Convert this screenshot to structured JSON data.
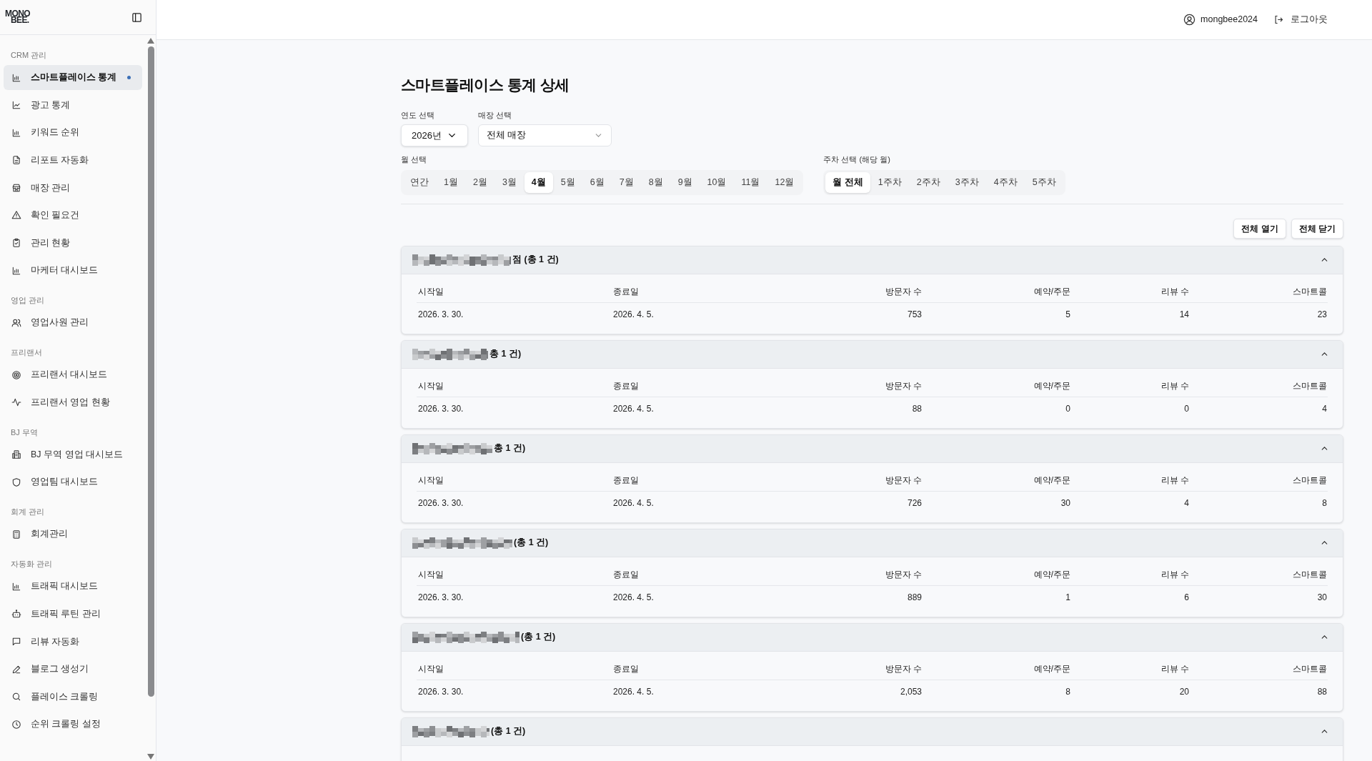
{
  "sidebar": {
    "logo": [
      "MONO",
      "BEE."
    ],
    "groups": [
      {
        "label": "CRM 관리",
        "items": [
          {
            "label": "스마트플레이스 통계",
            "selected": true
          },
          {
            "label": "광고 통계",
            "selected": false
          },
          {
            "label": "키워드 순위",
            "selected": false
          },
          {
            "label": "리포트 자동화",
            "selected": false
          },
          {
            "label": "매장 관리",
            "selected": false
          },
          {
            "label": "확인 필요건",
            "selected": false
          },
          {
            "label": "관리 현황",
            "selected": false
          },
          {
            "label": "마케터 대시보드",
            "selected": false
          }
        ]
      },
      {
        "label": "영업 관리",
        "items": [
          {
            "label": "영업사원 관리",
            "selected": false
          }
        ]
      },
      {
        "label": "프리랜서",
        "items": [
          {
            "label": "프리랜서 대시보드",
            "selected": false
          },
          {
            "label": "프리랜서 영업 현황",
            "selected": false
          }
        ]
      },
      {
        "label": "BJ 무역",
        "items": [
          {
            "label": "BJ 무역 영업 대시보드",
            "selected": false
          },
          {
            "label": "영업팀 대시보드",
            "selected": false
          }
        ]
      },
      {
        "label": "회계 관리",
        "items": [
          {
            "label": "회계관리",
            "selected": false
          }
        ]
      },
      {
        "label": "자동화 관리",
        "items": [
          {
            "label": "트래픽 대시보드",
            "selected": false
          },
          {
            "label": "트래픽 루틴 관리",
            "selected": false
          },
          {
            "label": "리뷰 자동화",
            "selected": false
          },
          {
            "label": "블로그 생성기",
            "selected": false
          },
          {
            "label": "플레이스 크롤링",
            "selected": false
          },
          {
            "label": "순위 크롤링 설정",
            "selected": false
          }
        ]
      }
    ]
  },
  "header": {
    "username": "mongbee2024",
    "logout": "로그아웃"
  },
  "page": {
    "title": "스마트플레이스 통계 상세",
    "year_select": {
      "label": "연도 선택",
      "value": "2026년"
    },
    "store_select": {
      "label": "매장 선택",
      "value": "전체 매장"
    },
    "month_label": "월 선택",
    "months": [
      {
        "label": "연간",
        "selected": false
      },
      {
        "label": "1월",
        "selected": false
      },
      {
        "label": "2월",
        "selected": false
      },
      {
        "label": "3월",
        "selected": false
      },
      {
        "label": "4월",
        "selected": true
      },
      {
        "label": "5월",
        "selected": false
      },
      {
        "label": "6월",
        "selected": false
      },
      {
        "label": "7월",
        "selected": false
      },
      {
        "label": "8월",
        "selected": false
      },
      {
        "label": "9월",
        "selected": false
      },
      {
        "label": "10월",
        "selected": false
      },
      {
        "label": "11월",
        "selected": false
      },
      {
        "label": "12월",
        "selected": false
      }
    ],
    "week_label": "주차 선택 (해당 월)",
    "weeks": [
      {
        "label": "월 전체",
        "selected": true
      },
      {
        "label": "1주차",
        "selected": false
      },
      {
        "label": "2주차",
        "selected": false
      },
      {
        "label": "3주차",
        "selected": false
      },
      {
        "label": "4주차",
        "selected": false
      },
      {
        "label": "5주차",
        "selected": false
      }
    ],
    "expand_all": "전체 열기",
    "collapse_all": "전체 닫기",
    "stores": [
      {
        "title_visible": "점 (총 1 건)",
        "expanded": true,
        "columns": [
          "시작일",
          "종료일",
          "방문자 수",
          "예약/주문",
          "리뷰 수",
          "스마트콜"
        ],
        "rows": [
          [
            "2026. 3. 30.",
            "2026. 4. 5.",
            "753",
            "5",
            "14",
            "23"
          ]
        ]
      },
      {
        "title_visible": "총 1 건)",
        "expanded": true,
        "columns": [
          "시작일",
          "종료일",
          "방문자 수",
          "예약/주문",
          "리뷰 수",
          "스마트콜"
        ],
        "rows": [
          [
            "2026. 3. 30.",
            "2026. 4. 5.",
            "88",
            "0",
            "0",
            "4"
          ]
        ]
      },
      {
        "title_visible": "총 1 건)",
        "expanded": true,
        "columns": [
          "시작일",
          "종료일",
          "방문자 수",
          "예약/주문",
          "리뷰 수",
          "스마트콜"
        ],
        "rows": [
          [
            "2026. 3. 30.",
            "2026. 4. 5.",
            "726",
            "30",
            "4",
            "8"
          ]
        ]
      },
      {
        "title_visible": "(총 1 건)",
        "expanded": true,
        "columns": [
          "시작일",
          "종료일",
          "방문자 수",
          "예약/주문",
          "리뷰 수",
          "스마트콜"
        ],
        "rows": [
          [
            "2026. 3. 30.",
            "2026. 4. 5.",
            "889",
            "1",
            "6",
            "30"
          ]
        ]
      },
      {
        "title_visible": "(총 1 건)",
        "expanded": true,
        "columns": [
          "시작일",
          "종료일",
          "방문자 수",
          "예약/주문",
          "리뷰 수",
          "스마트콜"
        ],
        "rows": [
          [
            "2026. 3. 30.",
            "2026. 4. 5.",
            "2,053",
            "8",
            "20",
            "88"
          ]
        ]
      },
      {
        "title_visible": "(총 1 건)",
        "expanded": true
      }
    ]
  }
}
